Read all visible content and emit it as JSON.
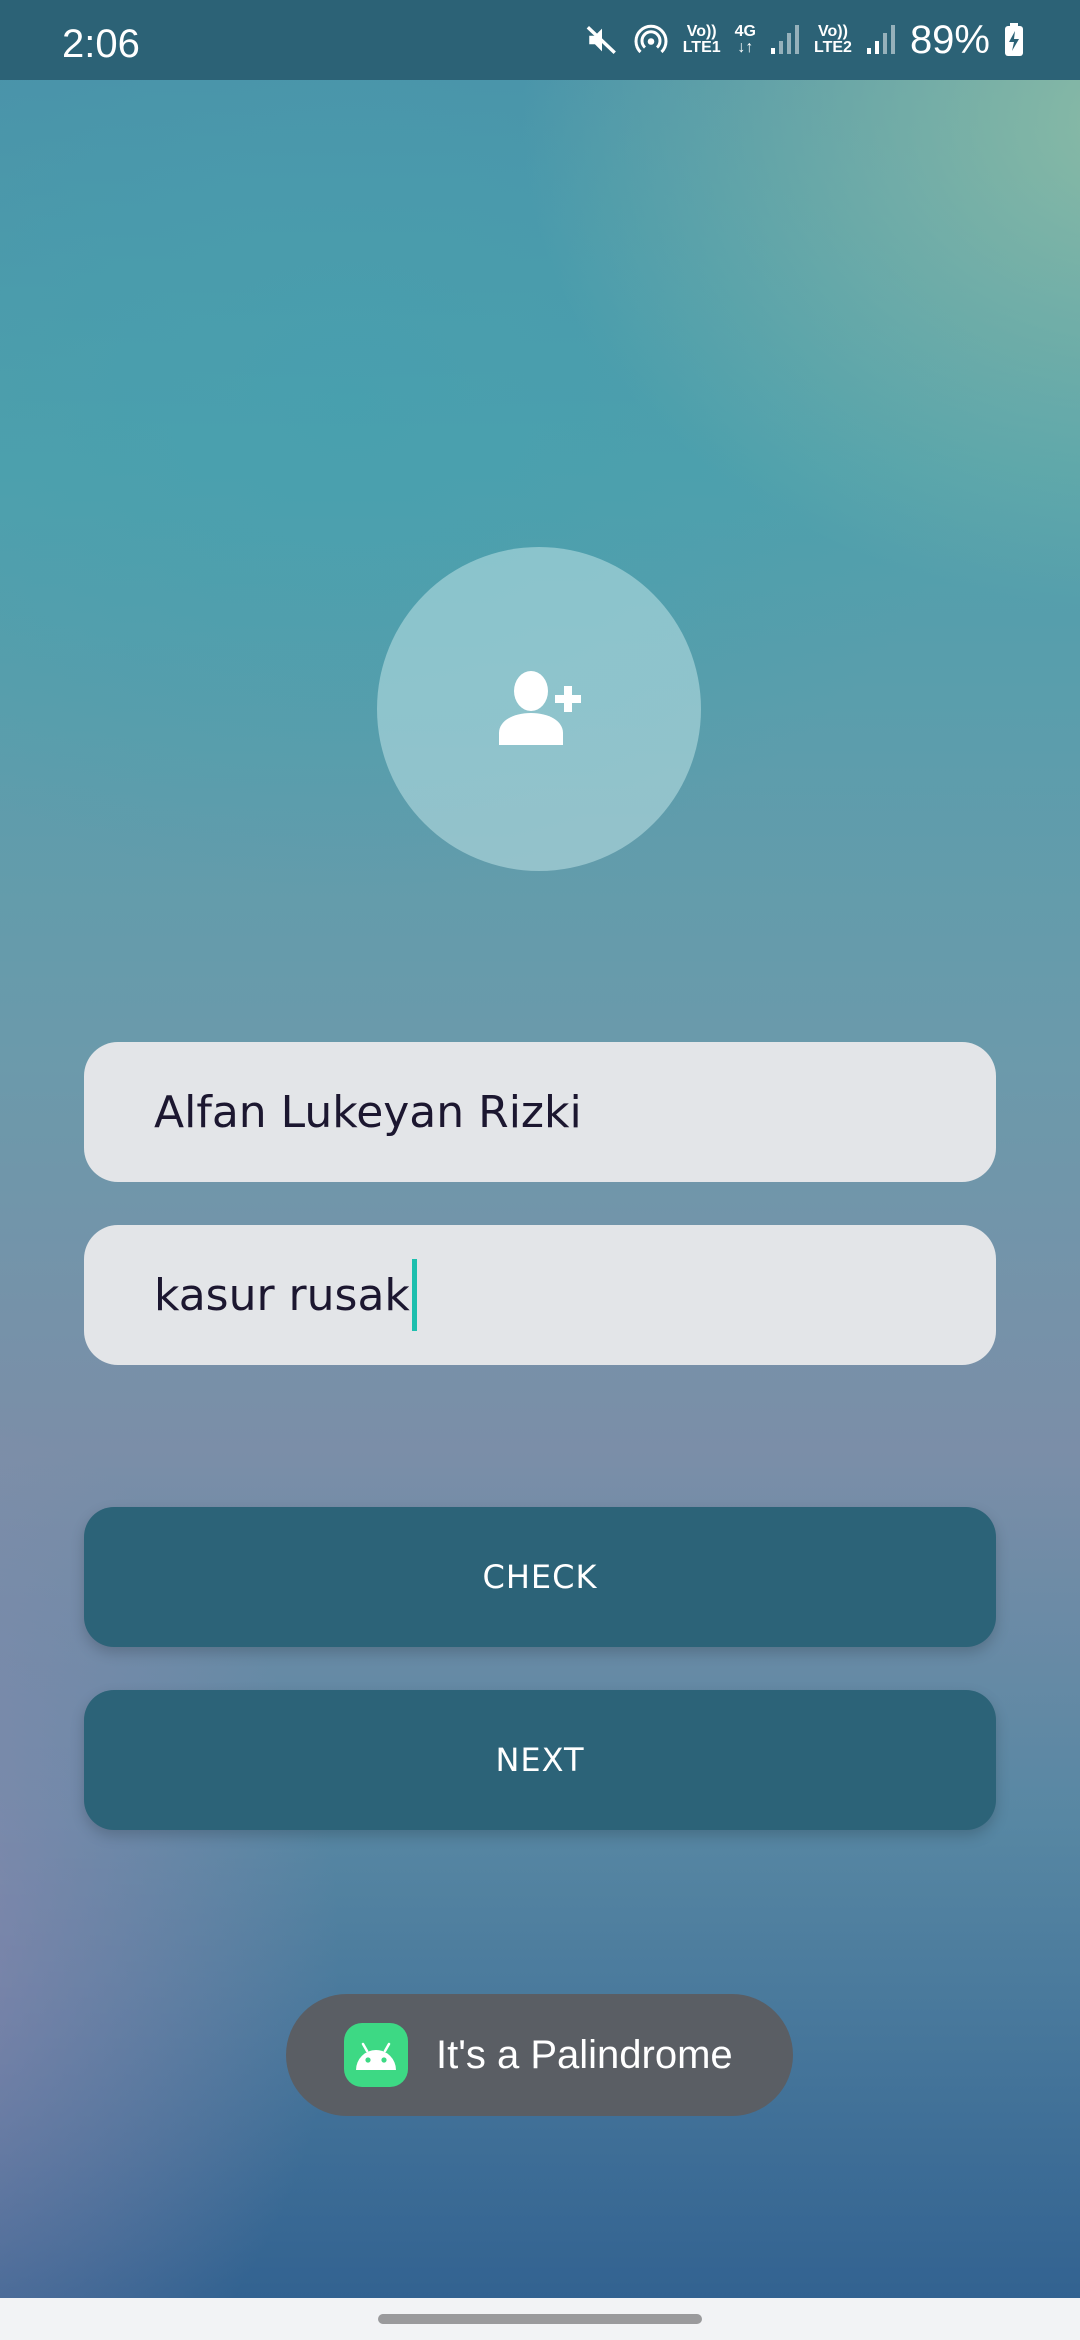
{
  "status_bar": {
    "time": "2:06",
    "icons": [
      "mute-icon",
      "hotspot-icon",
      "volte-lte1-icon",
      "4g-data-icon",
      "signal-sim1-icon",
      "volte-lte2-icon",
      "signal-sim2-icon",
      "battery-charging-icon"
    ],
    "volte1_top": "Vo))",
    "volte1_bottom": "LTE1",
    "data_top": "4G",
    "data_bottom": "↓↑",
    "volte2_top": "Vo))",
    "volte2_bottom": "LTE2",
    "battery": "89%"
  },
  "avatar": {
    "icon": "add-user-icon"
  },
  "form": {
    "name_value": "Alfan Lukeyan Rizki",
    "sentence_value": "kasur rusak"
  },
  "buttons": {
    "check_label": "CHECK",
    "next_label": "NEXT"
  },
  "toast": {
    "icon": "android-icon",
    "message": "It's a Palindrome"
  },
  "colors": {
    "status_bar": "#2c6276",
    "button": "#2c6378",
    "field_bg": "#e3e5e8",
    "caret": "#1dbfae",
    "toast_bg": "#5a5e64"
  }
}
